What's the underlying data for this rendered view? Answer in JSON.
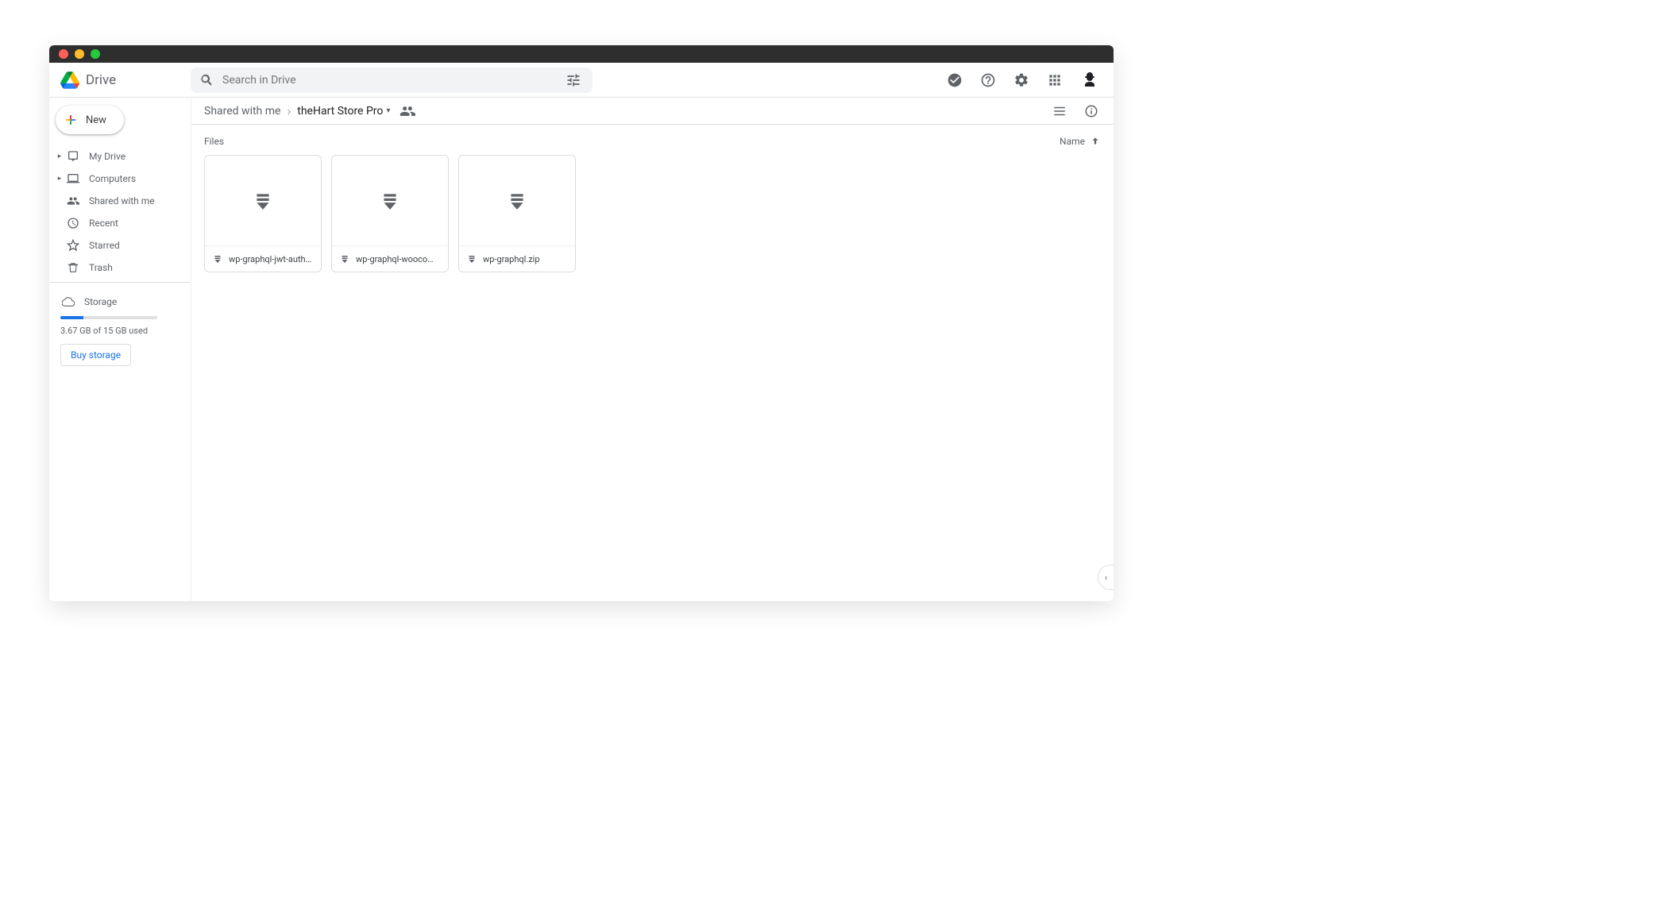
{
  "header": {
    "brand": "Drive",
    "search_placeholder": "Search in Drive"
  },
  "sidebar": {
    "new_label": "New",
    "items": [
      {
        "label": "My Drive"
      },
      {
        "label": "Computers"
      },
      {
        "label": "Shared with me"
      },
      {
        "label": "Recent"
      },
      {
        "label": "Starred"
      },
      {
        "label": "Trash"
      }
    ],
    "storage_label": "Storage",
    "storage_text": "3.67 GB of 15 GB used",
    "buy_label": "Buy storage"
  },
  "breadcrumbs": {
    "root": "Shared with me",
    "current": "theHart Store Pro"
  },
  "content": {
    "section_label": "Files",
    "sort_label": "Name",
    "files": [
      {
        "name": "wp-graphql-jwt-authen…"
      },
      {
        "name": "wp-graphql-woocomm…"
      },
      {
        "name": "wp-graphql.zip"
      }
    ]
  }
}
